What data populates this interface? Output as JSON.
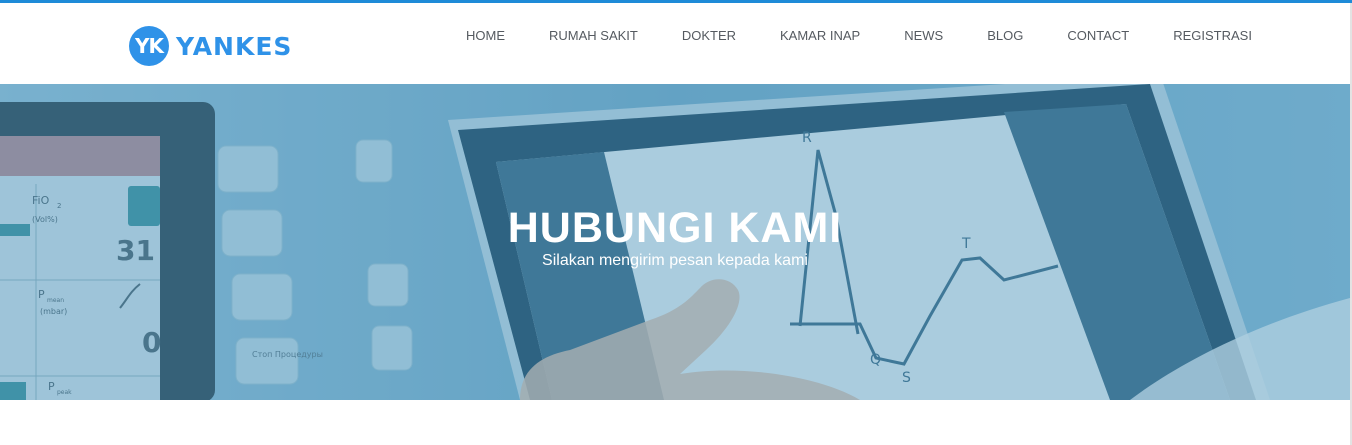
{
  "brand": {
    "badge": "YK",
    "name": "YANKES",
    "accent_color": "#2f92e8"
  },
  "nav": {
    "items": [
      {
        "label": "HOME"
      },
      {
        "label": "RUMAH SAKIT"
      },
      {
        "label": "DOKTER"
      },
      {
        "label": "KAMAR INAP"
      },
      {
        "label": "NEWS"
      },
      {
        "label": "BLOG"
      },
      {
        "label": "CONTACT"
      },
      {
        "label": "REGISTRASI"
      }
    ]
  },
  "hero": {
    "title": "HUBUNGI KAMI",
    "subtitle": "Silakan mengirim pesan kepada kami",
    "background_image": "medical-monitor-touchscreen-photo",
    "overlay_color": "#5a9ec2"
  },
  "monitor": {
    "readings": [
      {
        "label": "FiO",
        "sub": "2",
        "unit": "(Vol%)",
        "value": "31"
      },
      {
        "label": "P",
        "sub": "mean",
        "unit": "(mbar)",
        "value": "0"
      },
      {
        "label": "P",
        "sub": "peak",
        "unit": "",
        "value": ""
      }
    ],
    "buttons": [
      "Стоп Процедуры"
    ]
  },
  "ecg": {
    "waves": [
      "R",
      "T",
      "Q",
      "S"
    ]
  }
}
